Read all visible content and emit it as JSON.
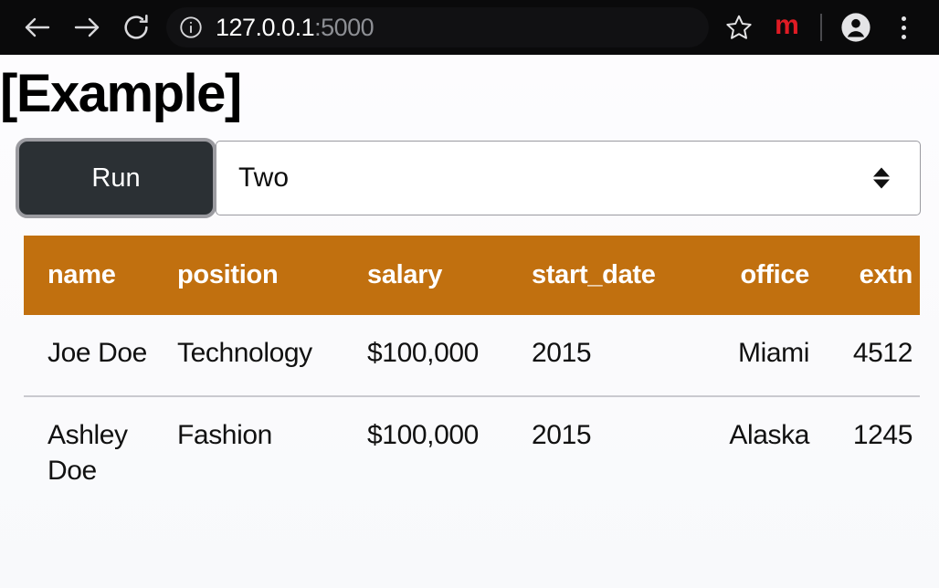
{
  "browser": {
    "back_label": "Back",
    "forward_label": "Forward",
    "reload_label": "Reload",
    "site_info_label": "Site information",
    "url_host": "127.0.0.1",
    "url_port": ":5000",
    "bookmark_label": "Bookmark this page",
    "extension_label": "m",
    "profile_label": "Profile",
    "menu_label": "Customize and control",
    "icons": {
      "back": "arrow-left-icon",
      "forward": "arrow-right-icon",
      "reload": "reload-icon",
      "info": "info-circle-icon",
      "star": "star-icon",
      "extension": "extension-m-icon",
      "avatar": "profile-avatar-icon",
      "menu": "three-dot-menu-icon"
    }
  },
  "page": {
    "title": "[Example]"
  },
  "controls": {
    "run_label": "Run",
    "select_value": "Two",
    "select_options": [
      "Two"
    ]
  },
  "table": {
    "columns": [
      "name",
      "position",
      "salary",
      "start_date",
      "office",
      "extn"
    ],
    "rows": [
      {
        "name": "Joe Doe",
        "position": "Technology",
        "salary": "$100,000",
        "start_date": "2015",
        "office": "Miami",
        "extn": "4512"
      },
      {
        "name": "Ashley Doe",
        "position": "Fashion",
        "salary": "$100,000",
        "start_date": "2015",
        "office": "Alaska",
        "extn": "1245"
      }
    ]
  },
  "colors": {
    "header_orange": "#c1700f",
    "run_button_bg": "#2b3034",
    "focus_ring": "#9b9ba0",
    "chrome_bg": "#0a0a0b",
    "extension_red": "#e01b24"
  }
}
